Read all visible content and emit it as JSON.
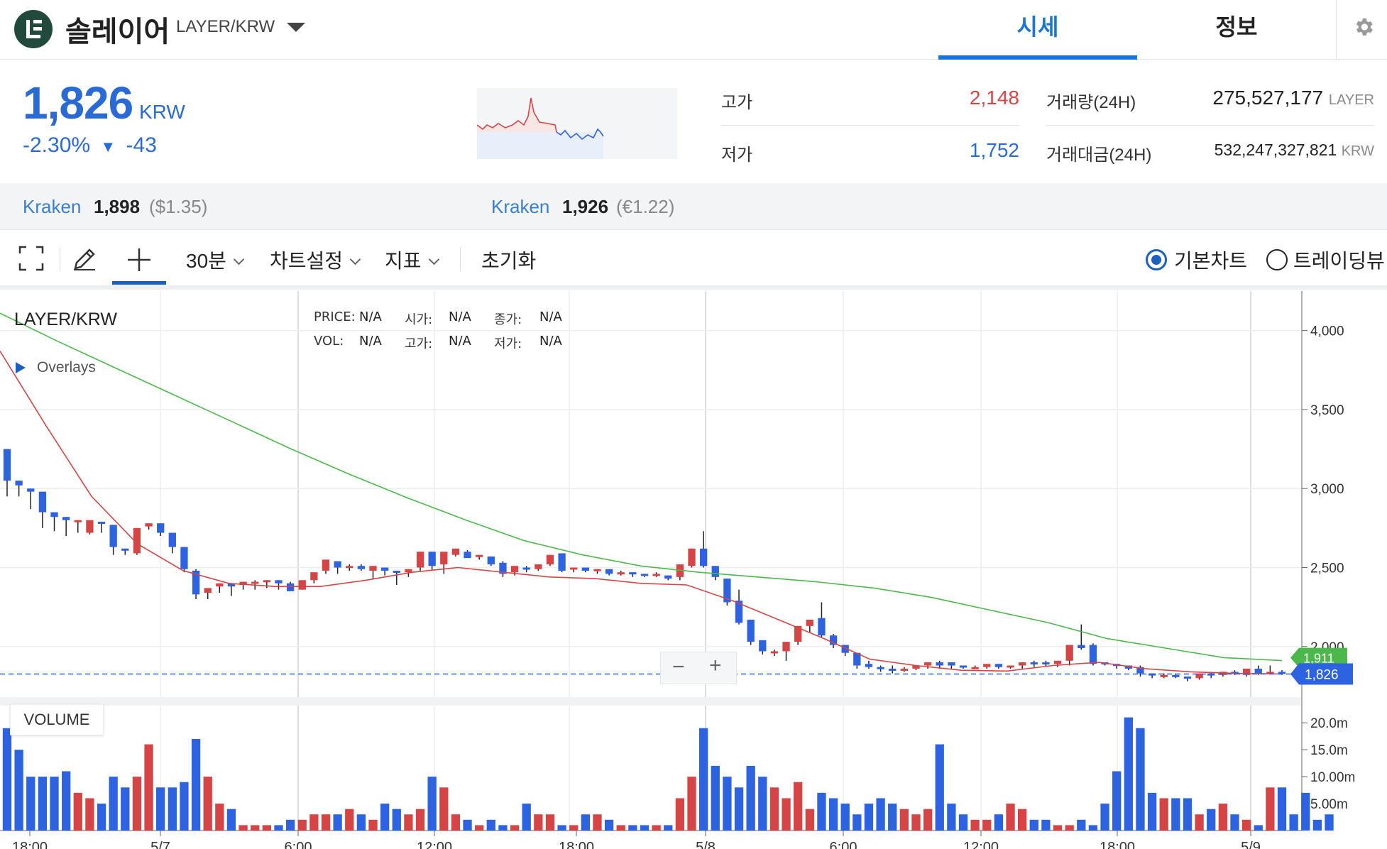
{
  "header": {
    "coin_name": "솔레이어",
    "pair": "LAYER/KRW",
    "tabs": [
      "시세",
      "정보"
    ],
    "active_tab": "시세"
  },
  "ticker": {
    "price": "1,826",
    "currency": "KRW",
    "change_pct": "-2.30%",
    "change_arrow": "▼",
    "change_abs": "-43",
    "high_label": "고가",
    "high": "2,148",
    "low_label": "저가",
    "low": "1,752",
    "volume_label": "거래량(24H)",
    "volume": "275,527,177",
    "volume_unit": "LAYER",
    "value_label": "거래대금(24H)",
    "value": "532,247,327,821",
    "value_unit": "KRW"
  },
  "exchanges": [
    {
      "name": "Kraken",
      "price": "1,898",
      "sub": "($1.35)"
    },
    {
      "name": "Kraken",
      "price": "1,926",
      "sub": "(€1.22)"
    }
  ],
  "toolbar": {
    "interval": "30분",
    "chart_settings": "차트설정",
    "indicators": "지표",
    "reset": "초기화",
    "view_basic": "기본차트",
    "view_trading": "트레이딩뷰",
    "selected_view": "기본차트"
  },
  "chart": {
    "symbol": "LAYER/KRW",
    "overlays_label": "Overlays",
    "info": {
      "price_label": "PRICE:",
      "price": "N/A",
      "vol_label": "VOL:",
      "vol": "N/A",
      "open_label": "시가:",
      "open": "N/A",
      "high_label": "고가:",
      "high": "N/A",
      "close_label": "종가:",
      "close": "N/A",
      "low_label": "저가:",
      "low": "N/A"
    },
    "volume_label": "VOLUME",
    "ma_long_tag": "1,911",
    "last_tag": "1,826",
    "zoom_out": "−",
    "zoom_in": "+"
  },
  "chart_data": {
    "type": "candlestick",
    "y_ticks": [
      "4,000",
      "3,500",
      "3,000",
      "2,500",
      "2,000"
    ],
    "volume_ticks": [
      "20.0m",
      "15.0m",
      "10.00m",
      "5.00m"
    ],
    "x_ticks": [
      "18:00",
      "5/7",
      "6:00",
      "12:00",
      "18:00",
      "5/8",
      "6:00",
      "12:00",
      "18:00",
      "5/9"
    ],
    "ylim": [
      1700,
      4200
    ],
    "volume_ylim": [
      0,
      22
    ],
    "last_price": 1826,
    "colors": {
      "up": "#d64545",
      "down": "#2d63e0",
      "ma_short": "#d64545",
      "ma_long": "#4cb84c"
    },
    "ma_long": [
      4110,
      3930,
      3760,
      3590,
      3420,
      3250,
      3090,
      2940,
      2800,
      2670,
      2580,
      2510,
      2470,
      2440,
      2410,
      2370,
      2310,
      2230,
      2150,
      2050,
      1990,
      1930,
      1911
    ],
    "ma_short": [
      3870,
      3400,
      2950,
      2650,
      2480,
      2400,
      2380,
      2380,
      2420,
      2470,
      2500,
      2470,
      2440,
      2430,
      2400,
      2390,
      2290,
      2170,
      2050,
      1920,
      1880,
      1850,
      1845,
      1880,
      1900,
      1860,
      1840,
      1830,
      1826
    ],
    "candles": [
      [
        3250,
        3220,
        3050,
        2950
      ],
      [
        3050,
        3000,
        3020,
        2950
      ],
      [
        3000,
        2980,
        2980,
        2870
      ],
      [
        2980,
        2920,
        2850,
        2750
      ],
      [
        2850,
        2820,
        2820,
        2730
      ],
      [
        2820,
        2800,
        2800,
        2700
      ],
      [
        2800,
        2760,
        2800,
        2720
      ],
      [
        2720,
        2800,
        2800,
        2710
      ],
      [
        2790,
        2760,
        2780,
        2720
      ],
      [
        2770,
        2630,
        2630,
        2580
      ],
      [
        2620,
        2580,
        2610,
        2580
      ],
      [
        2590,
        2600,
        2750,
        2580
      ],
      [
        2760,
        2770,
        2780,
        2740
      ],
      [
        2780,
        2780,
        2720,
        2700
      ],
      [
        2720,
        2710,
        2630,
        2590
      ],
      [
        2630,
        2620,
        2490,
        2470
      ],
      [
        2480,
        2490,
        2330,
        2300
      ],
      [
        2340,
        2350,
        2370,
        2300
      ],
      [
        2380,
        2380,
        2400,
        2340
      ],
      [
        2400,
        2390,
        2380,
        2320
      ],
      [
        2390,
        2390,
        2410,
        2360
      ],
      [
        2410,
        2420,
        2410,
        2360
      ],
      [
        2410,
        2410,
        2420,
        2370
      ],
      [
        2420,
        2420,
        2400,
        2360
      ],
      [
        2400,
        2410,
        2350,
        2350
      ],
      [
        2360,
        2400,
        2420,
        2360
      ],
      [
        2420,
        2420,
        2470,
        2400
      ],
      [
        2480,
        2490,
        2550,
        2460
      ],
      [
        2540,
        2540,
        2500,
        2460
      ],
      [
        2500,
        2520,
        2510,
        2480
      ],
      [
        2510,
        2520,
        2490,
        2480
      ],
      [
        2480,
        2470,
        2510,
        2430
      ],
      [
        2500,
        2500,
        2480,
        2450
      ],
      [
        2480,
        2470,
        2470,
        2390
      ],
      [
        2470,
        2450,
        2490,
        2440
      ],
      [
        2500,
        2500,
        2600,
        2480
      ],
      [
        2600,
        2600,
        2510,
        2480
      ],
      [
        2520,
        2530,
        2600,
        2460
      ],
      [
        2580,
        2600,
        2620,
        2570
      ],
      [
        2600,
        2610,
        2560,
        2560
      ],
      [
        2580,
        2580,
        2580,
        2550
      ],
      [
        2570,
        2570,
        2520,
        2510
      ],
      [
        2530,
        2540,
        2460,
        2440
      ],
      [
        2470,
        2480,
        2510,
        2450
      ],
      [
        2500,
        2510,
        2490,
        2470
      ],
      [
        2490,
        2500,
        2520,
        2480
      ],
      [
        2520,
        2530,
        2580,
        2510
      ],
      [
        2590,
        2590,
        2480,
        2470
      ],
      [
        2490,
        2490,
        2500,
        2470
      ],
      [
        2500,
        2500,
        2480,
        2470
      ],
      [
        2480,
        2480,
        2490,
        2460
      ],
      [
        2490,
        2490,
        2460,
        2450
      ],
      [
        2470,
        2480,
        2470,
        2450
      ],
      [
        2470,
        2470,
        2460,
        2440
      ],
      [
        2460,
        2460,
        2450,
        2440
      ],
      [
        2460,
        2470,
        2460,
        2440
      ],
      [
        2450,
        2450,
        2430,
        2420
      ],
      [
        2440,
        2430,
        2520,
        2420
      ],
      [
        2510,
        2610,
        2620,
        2500
      ],
      [
        2620,
        2730,
        2510,
        2500
      ],
      [
        2510,
        2510,
        2440,
        2420
      ],
      [
        2430,
        2400,
        2280,
        2260
      ],
      [
        2290,
        2360,
        2150,
        2140
      ],
      [
        2170,
        2170,
        2030,
        2010
      ],
      [
        2040,
        2040,
        1970,
        1950
      ],
      [
        1970,
        1980,
        1970,
        1940
      ],
      [
        1970,
        1960,
        2030,
        1910
      ],
      [
        2030,
        2030,
        2130,
        2010
      ],
      [
        2130,
        2160,
        2170,
        2090
      ],
      [
        2180,
        2280,
        2070,
        2060
      ],
      [
        2070,
        2080,
        2010,
        1990
      ],
      [
        2010,
        2010,
        1960,
        1940
      ],
      [
        1960,
        1960,
        1880,
        1860
      ],
      [
        1890,
        1910,
        1870,
        1860
      ],
      [
        1870,
        1880,
        1860,
        1840
      ],
      [
        1860,
        1880,
        1850,
        1830
      ],
      [
        1860,
        1870,
        1860,
        1840
      ],
      [
        1860,
        1860,
        1880,
        1850
      ],
      [
        1880,
        1880,
        1900,
        1860
      ],
      [
        1900,
        1910,
        1880,
        1860
      ],
      [
        1900,
        1900,
        1880,
        1860
      ],
      [
        1880,
        1880,
        1870,
        1860
      ],
      [
        1870,
        1880,
        1870,
        1860
      ],
      [
        1870,
        1880,
        1890,
        1860
      ],
      [
        1890,
        1890,
        1870,
        1860
      ],
      [
        1870,
        1880,
        1880,
        1860
      ],
      [
        1880,
        1890,
        1900,
        1860
      ],
      [
        1900,
        1910,
        1890,
        1870
      ],
      [
        1900,
        1910,
        1890,
        1870
      ],
      [
        1890,
        1900,
        1910,
        1870
      ],
      [
        1910,
        2010,
        2010,
        1880
      ],
      [
        2010,
        2140,
        1990,
        1980
      ],
      [
        2010,
        2020,
        1890,
        1880
      ],
      [
        1900,
        1900,
        1890,
        1880
      ],
      [
        1890,
        1890,
        1880,
        1860
      ],
      [
        1880,
        1880,
        1860,
        1850
      ],
      [
        1870,
        1880,
        1830,
        1810
      ],
      [
        1830,
        1830,
        1820,
        1800
      ],
      [
        1820,
        1830,
        1820,
        1800
      ],
      [
        1820,
        1830,
        1810,
        1800
      ],
      [
        1810,
        1810,
        1800,
        1780
      ],
      [
        1800,
        1800,
        1830,
        1790
      ],
      [
        1830,
        1840,
        1820,
        1800
      ],
      [
        1820,
        1840,
        1840,
        1810
      ],
      [
        1840,
        1850,
        1830,
        1820
      ],
      [
        1820,
        1830,
        1860,
        1810
      ],
      [
        1860,
        1880,
        1830,
        1820
      ],
      [
        1840,
        1880,
        1840,
        1830
      ],
      [
        1840,
        1850,
        1830,
        1820
      ]
    ],
    "volumes": [
      19,
      15,
      10,
      10,
      10,
      11,
      7,
      6,
      5,
      10,
      8,
      10,
      16,
      8,
      8,
      9,
      17,
      10,
      5,
      4,
      1,
      1,
      1,
      1,
      2,
      2,
      3,
      3,
      3,
      4,
      3,
      2,
      5,
      4,
      3,
      4,
      10,
      8,
      3,
      2,
      1,
      2,
      1,
      1,
      5,
      3,
      3,
      1,
      1,
      3,
      3,
      2,
      1,
      1,
      1,
      1,
      1,
      6,
      10,
      19,
      12,
      10,
      8,
      12,
      10,
      8,
      6,
      9,
      4,
      7,
      6,
      5,
      3,
      5,
      6,
      5,
      4,
      3,
      4,
      16,
      5,
      3,
      2,
      2,
      3,
      5,
      4,
      2,
      2,
      1,
      1,
      2,
      1,
      5,
      11,
      21,
      19,
      7,
      6,
      6,
      6,
      3,
      4,
      5,
      3,
      2,
      1,
      8,
      8,
      3,
      7,
      2,
      3
    ]
  }
}
